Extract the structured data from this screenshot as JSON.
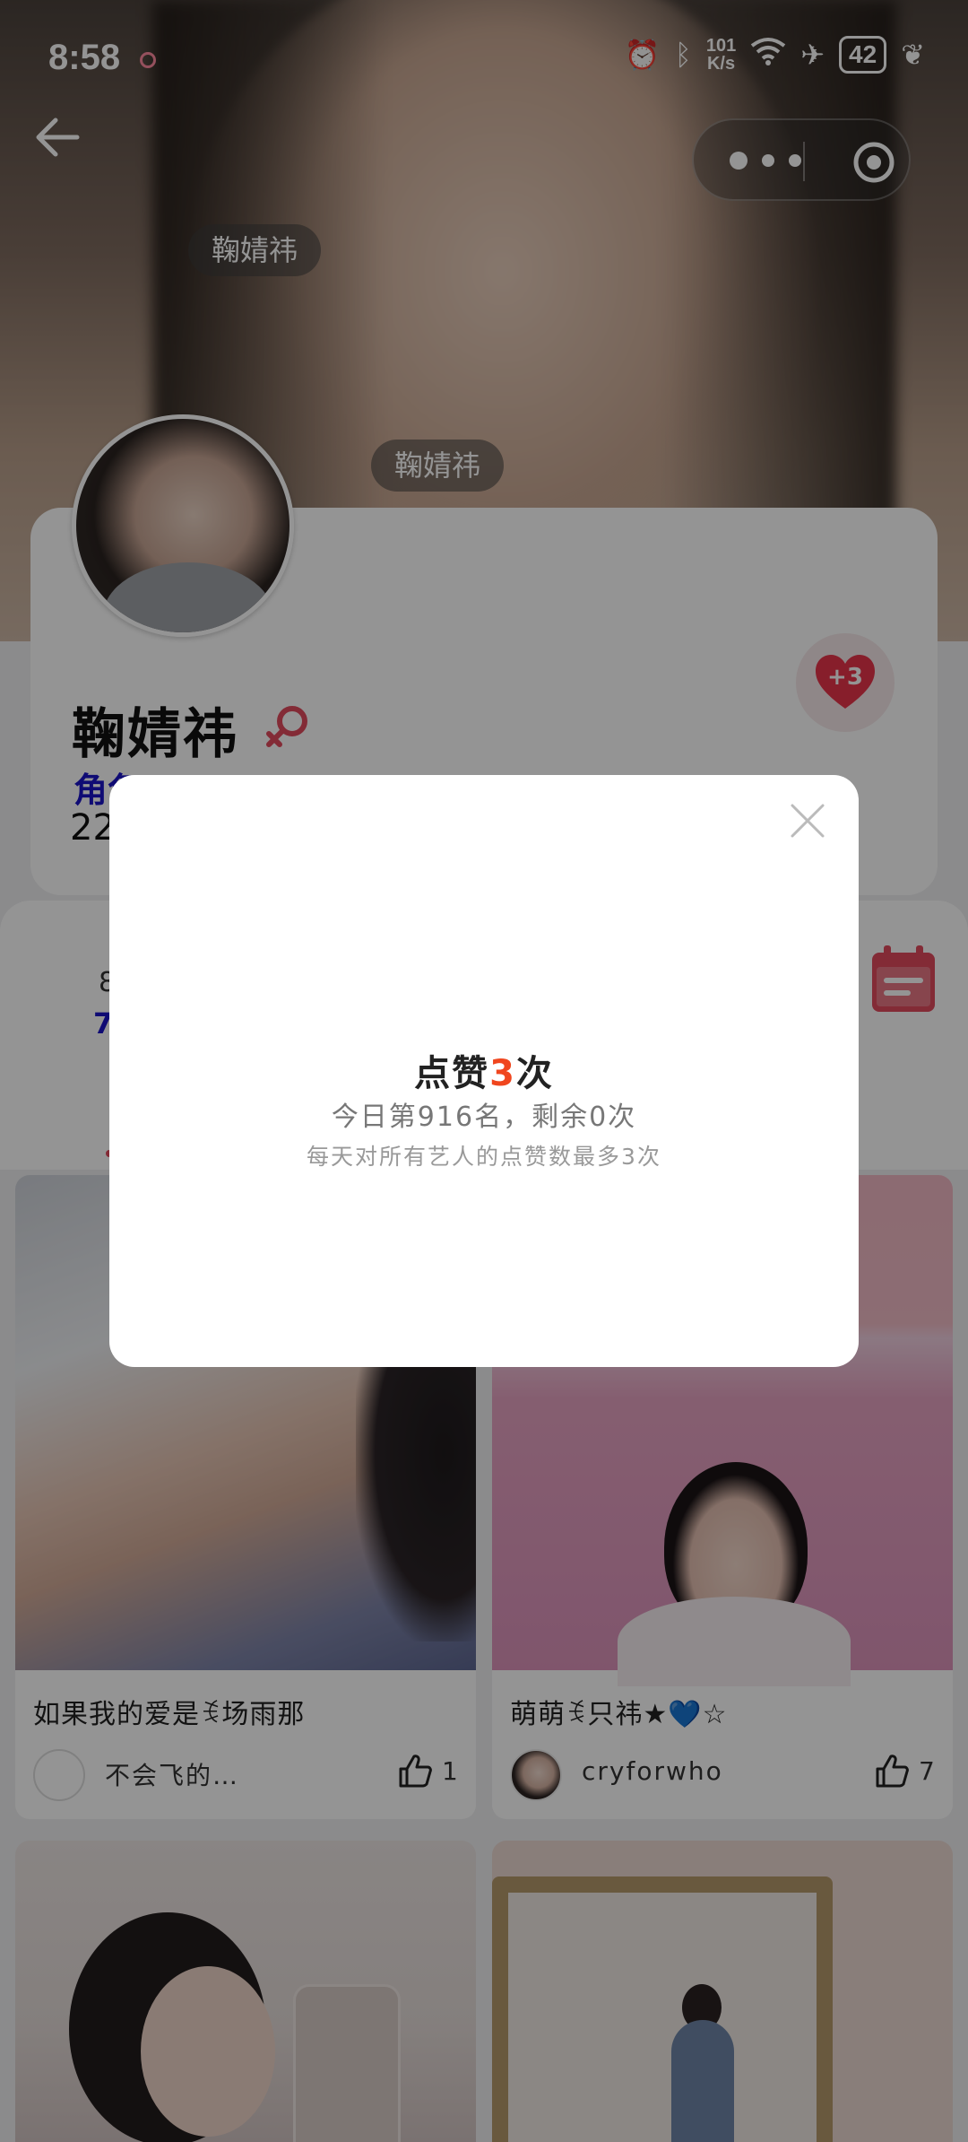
{
  "status_bar": {
    "time": "8:58",
    "network_speed_value": "101",
    "network_speed_unit": "K/s",
    "battery": "42"
  },
  "header": {
    "tag_top": "鞠婧祎",
    "tag_mid": "鞠婧祎"
  },
  "profile": {
    "name": "鞠婧祎",
    "role_label": "角色…",
    "fans_prefix": "22",
    "heart_badge": "+3"
  },
  "rank": {
    "line1": "8",
    "line2": "7"
  },
  "posts": [
    {
      "title": "如果我的爱是ꉂ场雨那",
      "user": "不会飞的…",
      "likes": "1"
    },
    {
      "title": "萌萌ꉂ只祎★💙☆",
      "user": "cryforwho",
      "likes": "7"
    }
  ],
  "modal": {
    "title_prefix": "点赞",
    "title_number": "3",
    "title_suffix": "次",
    "subtitle": "今日第916名，剩余0次",
    "hint": "每天对所有艺人的点赞数最多3次"
  },
  "colors": {
    "accent_red": "#e24a5e",
    "highlight_orange": "#f0461e",
    "role_blue": "#1a14c8"
  }
}
